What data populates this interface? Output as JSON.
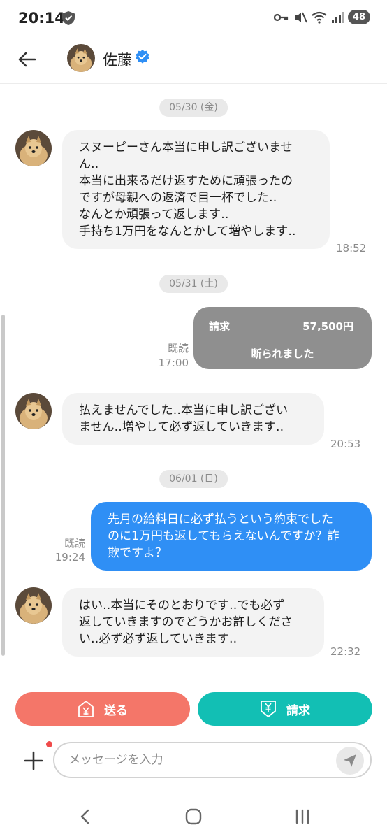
{
  "status_bar": {
    "time": "20:14",
    "battery": "48"
  },
  "header": {
    "contact_name": "佐藤"
  },
  "messages": [
    {
      "type": "date",
      "text": "05/30 (金)"
    },
    {
      "type": "incoming",
      "lines": [
        "スヌーピーさん本当に申し訳ございませ",
        "ん‥",
        "本当に出来るだけ返すために頑張ったの",
        "ですが母親への返済で目一杯でした‥",
        "なんとか頑張って返します‥",
        "手持ち1万円をなんとかして増やします‥"
      ],
      "time": "18:52"
    },
    {
      "type": "date",
      "text": "05/31 (土)"
    },
    {
      "type": "invoice",
      "label": "請求",
      "amount": "57,500円",
      "status": "断られました",
      "read": "既読",
      "time": "17:00"
    },
    {
      "type": "incoming",
      "lines": [
        "払えませんでした‥本当に申し訳ござい",
        "ません‥増やして必ず返していきます‥"
      ],
      "time": "20:53"
    },
    {
      "type": "date",
      "text": "06/01 (日)"
    },
    {
      "type": "outgoing",
      "lines": [
        "先月の給料日に必ず払うという約束でした",
        "のに1万円も返してもらえないんですか？詐",
        "欺ですよ？"
      ],
      "read": "既読",
      "time": "19:24"
    },
    {
      "type": "incoming",
      "lines": [
        "はい‥本当にそのとおりです‥でも必ず",
        "返していきますのでどうかお許しくださ",
        "い‥必ず必ず返していきます‥"
      ],
      "time": "22:32"
    }
  ],
  "actions": {
    "send_label": "送る",
    "request_label": "請求"
  },
  "composer": {
    "placeholder": "メッセージを入力"
  },
  "colors": {
    "outgoing_bubble": "#2f8ff5",
    "incoming_bubble": "#f3f3f3",
    "send_button": "#f47669",
    "request_button": "#12bfb4",
    "invoice_card": "#8f8f8f",
    "verified": "#2f8ff5"
  },
  "icons": [
    "shield-icon",
    "key-icon",
    "mute-icon",
    "wifi-icon",
    "signal-icon",
    "back-arrow-icon",
    "verified-badge-icon",
    "yen-send-icon",
    "yen-request-icon",
    "plus-icon",
    "send-arrow-icon",
    "nav-back-icon",
    "nav-home-icon",
    "nav-recents-icon"
  ]
}
